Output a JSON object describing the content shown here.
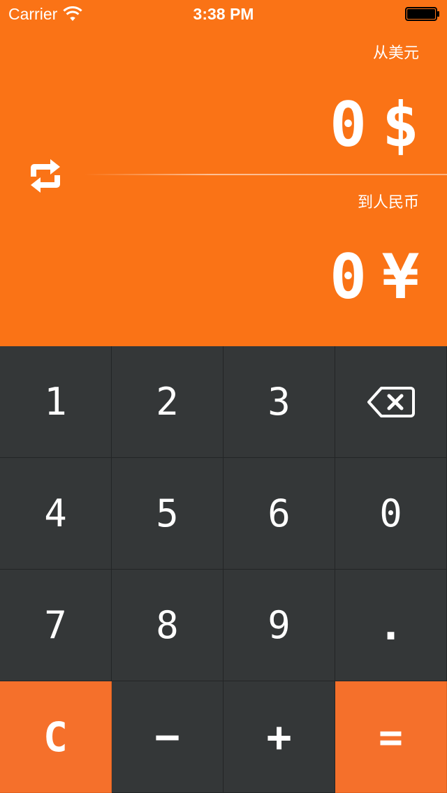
{
  "status_bar": {
    "carrier": "Carrier",
    "time": "3:38 PM"
  },
  "converter": {
    "from_label": "从美元",
    "from_value": "0",
    "from_symbol": "$",
    "to_label": "到人民币",
    "to_value": "0",
    "to_symbol": "¥",
    "swap_icon": "swap-arrows-icon"
  },
  "keypad": {
    "keys": [
      "1",
      "2",
      "3",
      "backspace",
      "4",
      "5",
      "6",
      "0",
      "7",
      "8",
      "9",
      ".",
      "C",
      "−",
      "+",
      "="
    ]
  },
  "colors": {
    "accent": "#fa7316",
    "key_orange": "#f5702b",
    "key_dark": "#343738",
    "text": "#ffffff"
  }
}
